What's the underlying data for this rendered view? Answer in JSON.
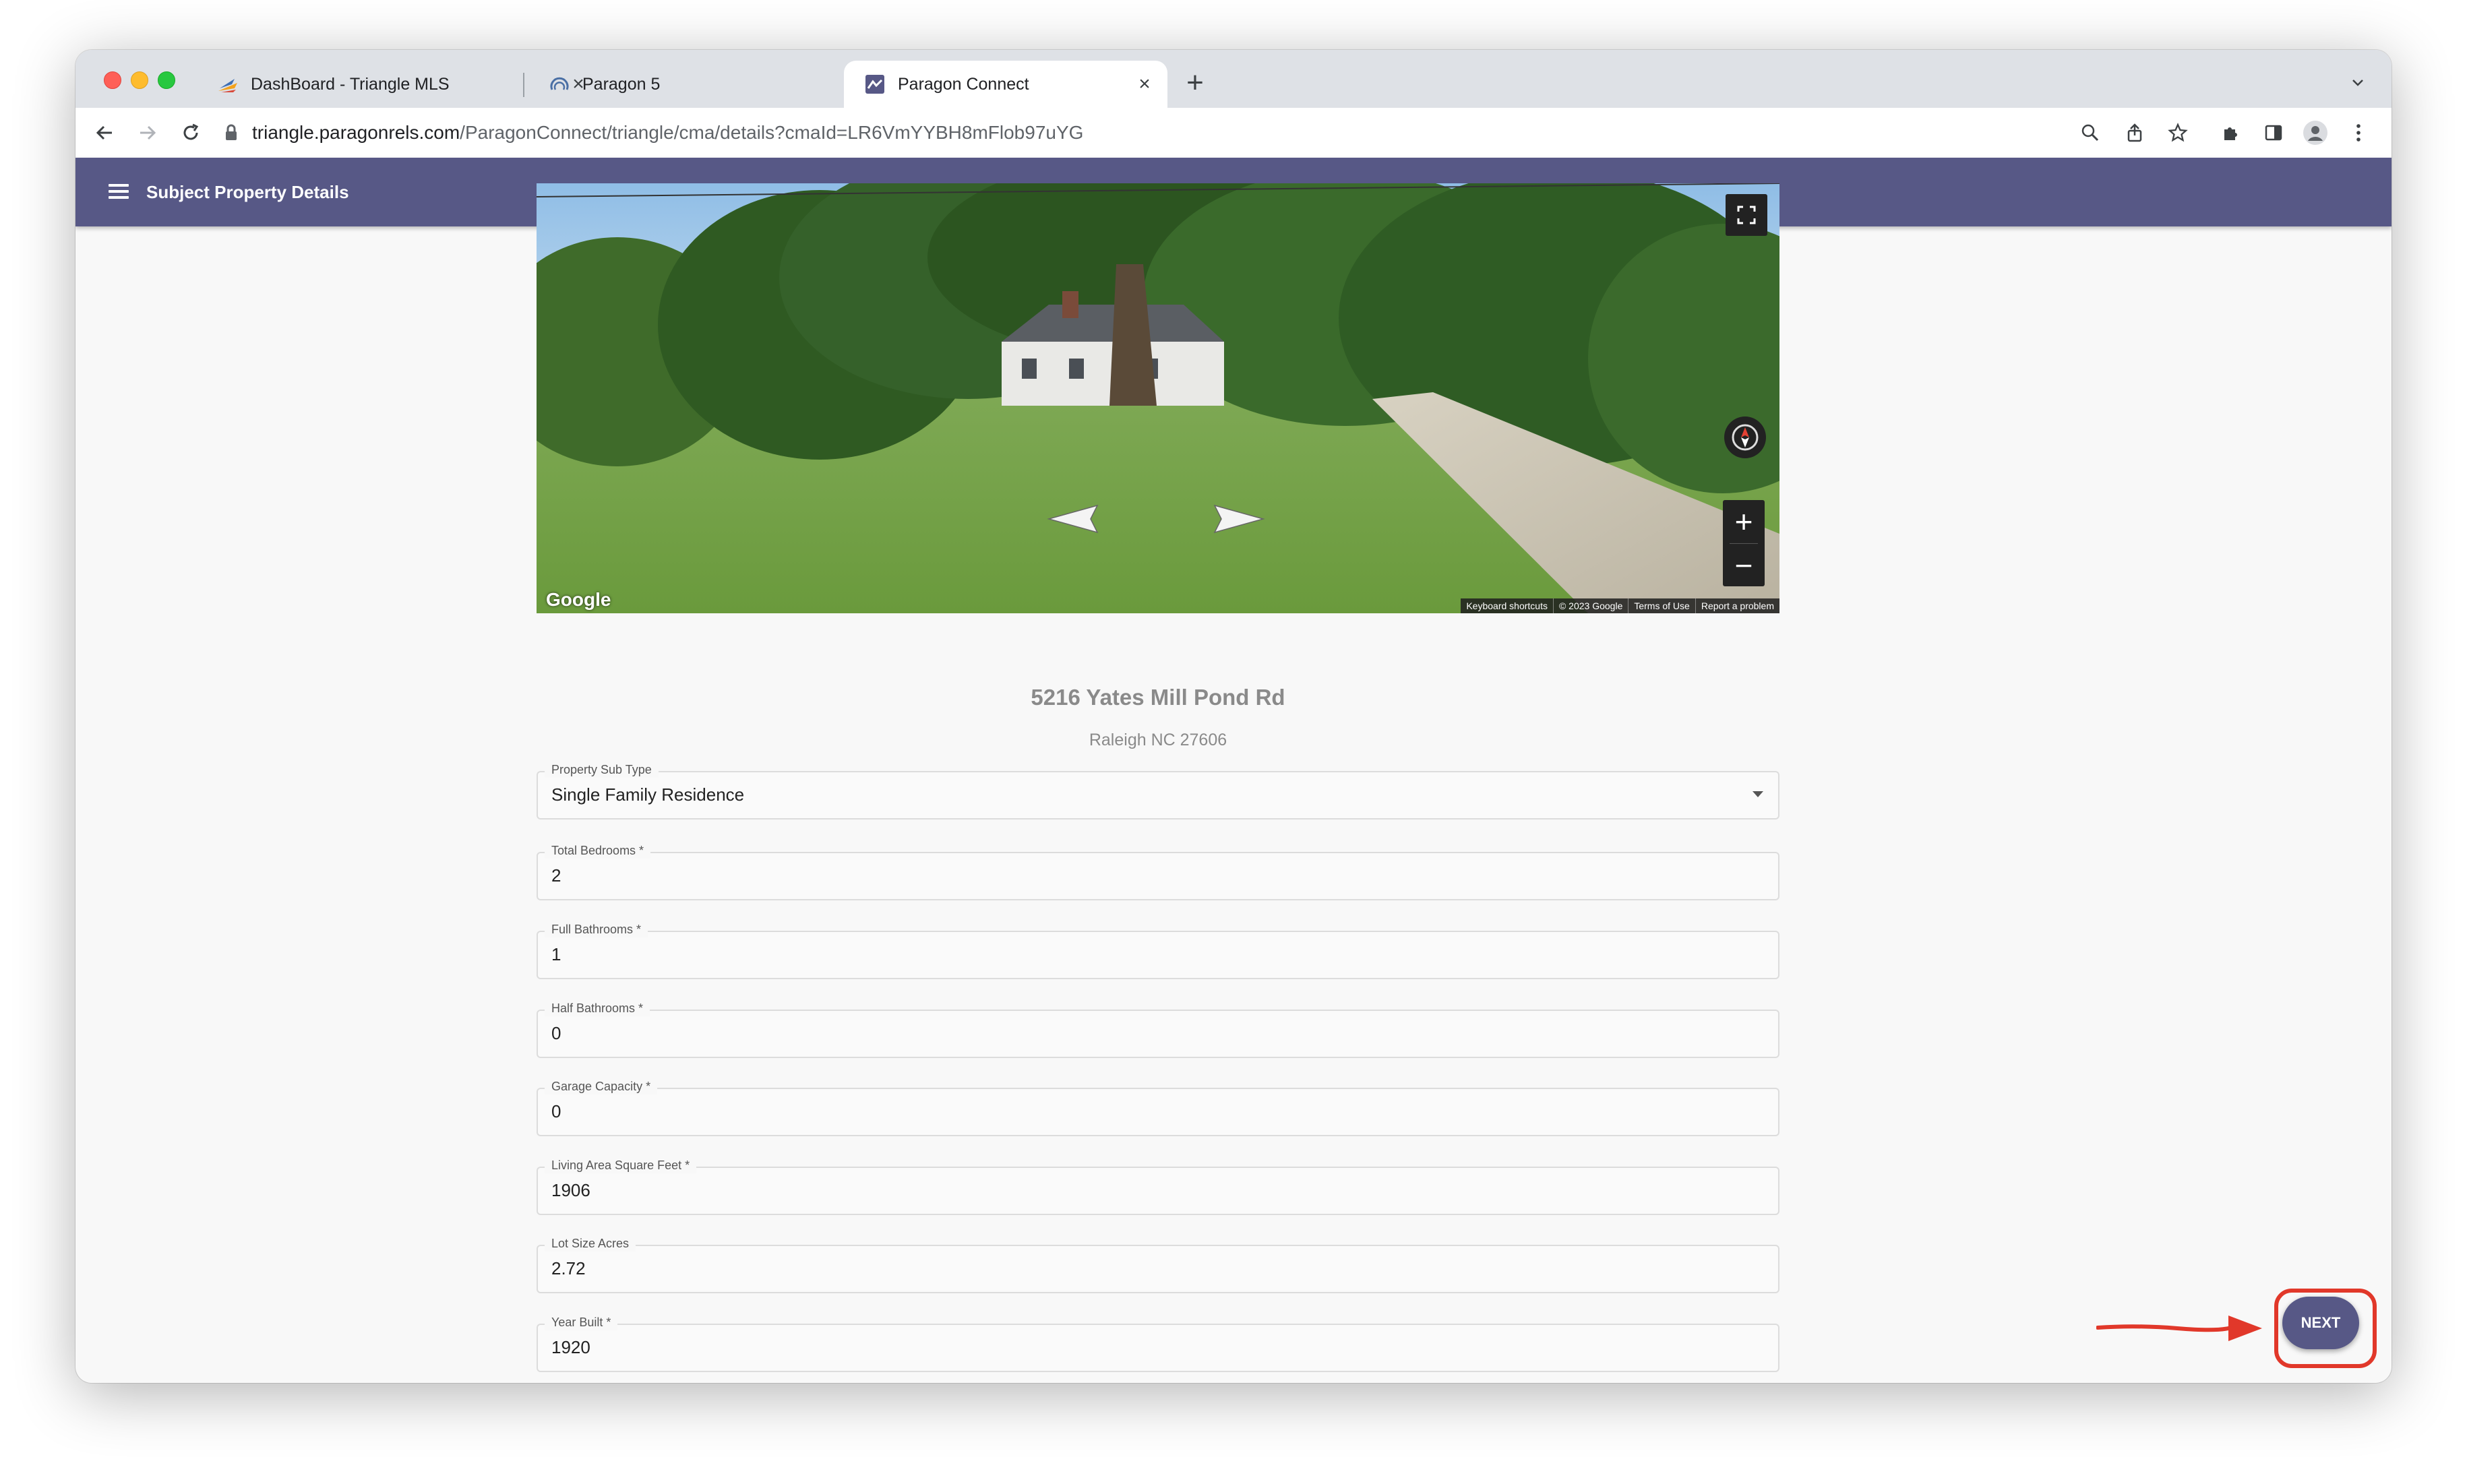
{
  "browser": {
    "tabs": [
      {
        "title": "DashBoard - Triangle MLS",
        "favicon": "triangle-mls-logo"
      },
      {
        "title": "Paragon 5",
        "favicon": "paragon-logo"
      },
      {
        "title": "Paragon Connect",
        "favicon": "paragon-connect-logo",
        "active": true
      }
    ],
    "url_domain": "triangle.paragonrels.com",
    "url_path": "/ParagonConnect/triangle/cma/details?cmaId=LR6VmYYBH8mFlob97uYG"
  },
  "app": {
    "title": "Subject Property Details",
    "accent_color": "#575886"
  },
  "street_view": {
    "watermark": "Google",
    "footer": [
      "Keyboard shortcuts",
      "© 2023 Google",
      "Terms of Use",
      "Report a problem"
    ]
  },
  "property": {
    "street": "5216 Yates Mill Pond Rd",
    "city_state_zip": "Raleigh NC 27606"
  },
  "fields": {
    "sub_type": {
      "label": "Property Sub Type",
      "value": "Single Family Residence"
    },
    "bedrooms": {
      "label": "Total Bedrooms *",
      "value": "2"
    },
    "full_baths": {
      "label": "Full Bathrooms *",
      "value": "1"
    },
    "half_baths": {
      "label": "Half Bathrooms *",
      "value": "0"
    },
    "garage": {
      "label": "Garage Capacity *",
      "value": "0"
    },
    "living_area": {
      "label": "Living Area Square Feet *",
      "value": "1906"
    },
    "lot_size": {
      "label": "Lot Size Acres",
      "value": "2.72"
    },
    "year_built": {
      "label": "Year Built *",
      "value": "1920"
    }
  },
  "actions": {
    "next_label": "NEXT",
    "highlight_color": "#e1382a"
  }
}
